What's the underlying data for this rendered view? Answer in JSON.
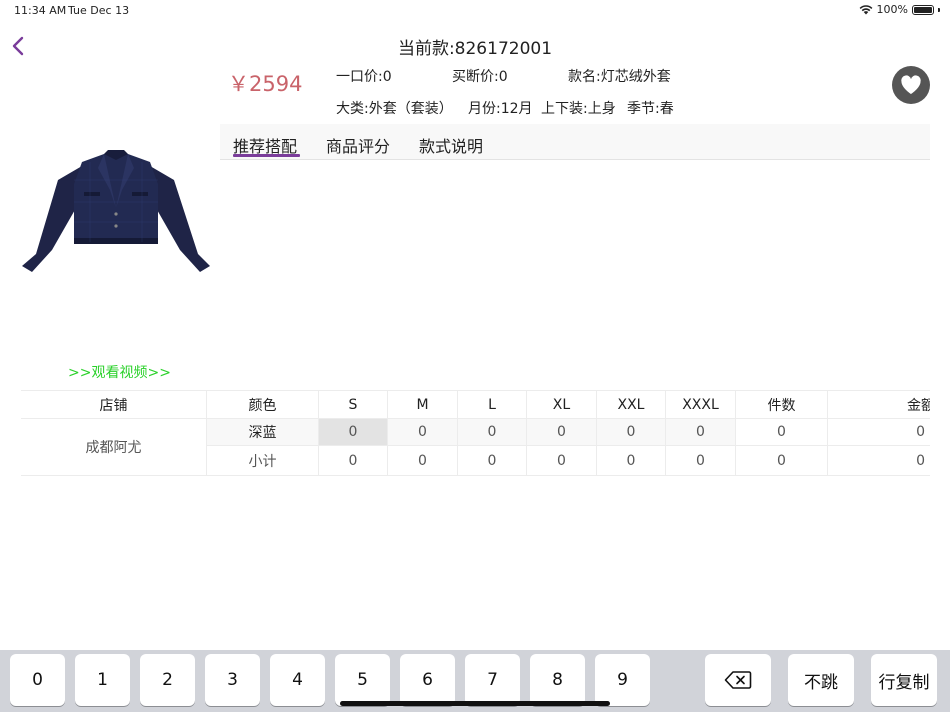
{
  "status": {
    "time": "11:34 AM",
    "date": "Tue Dec 13",
    "battery": "100%"
  },
  "header": {
    "title": "当前款:826172001"
  },
  "product": {
    "price": "￥2594",
    "yikou": "一口价:0",
    "maiduan": "买断价:0",
    "name": "款名:灯芯绒外套",
    "category": "大类:外套（套装）",
    "month": "月份:12月",
    "position": "上下装:上身",
    "season": "季节:春",
    "video_link": ">>观看视频>>"
  },
  "tabs": [
    {
      "label": "推荐搭配",
      "active": true
    },
    {
      "label": "商品评分"
    },
    {
      "label": "款式说明"
    }
  ],
  "table": {
    "headers": [
      "店铺",
      "颜色",
      "S",
      "M",
      "L",
      "XL",
      "XXL",
      "XXXL",
      "件数",
      "金额"
    ],
    "store": "成都阿尤",
    "rows": [
      {
        "color": "深蓝",
        "values": [
          "0",
          "0",
          "0",
          "0",
          "0",
          "0",
          "0",
          "0"
        ]
      },
      {
        "color": "小计",
        "values": [
          "0",
          "0",
          "0",
          "0",
          "0",
          "0",
          "0",
          "0"
        ]
      }
    ]
  },
  "keyboard": {
    "digits": [
      "0",
      "1",
      "2",
      "3",
      "4",
      "5",
      "6",
      "7",
      "8",
      "9"
    ],
    "no_jump": "不跳",
    "copy_row": "行复制"
  },
  "colors": {
    "accent": "#7a3c9a",
    "price": "#c9636a",
    "video": "#2bd12b"
  },
  "icons": [
    "wifi-icon",
    "battery-icon",
    "back-chevron-icon",
    "heart-icon",
    "backspace-icon"
  ]
}
